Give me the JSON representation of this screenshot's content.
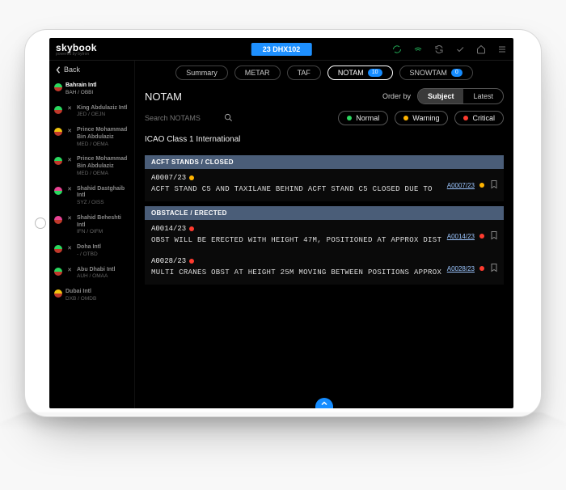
{
  "brand": {
    "name": "skybook",
    "sub": "powered by bytron"
  },
  "flight_pill": "23 DHX102",
  "nav": {
    "back": "Back"
  },
  "airports": [
    {
      "name": "Bahrain Intl",
      "code": "BAH / OBBI",
      "c1": "#2bd85f",
      "c2": "#c0392b",
      "selected": true,
      "alt": false
    },
    {
      "name": "King Abdulaziz Intl",
      "code": "JED / OEJN",
      "c1": "#2bd85f",
      "c2": "#c0392b",
      "alt": true
    },
    {
      "name": "Prince Mohammad Bin Abdulaziz",
      "code": "MED / OEMA",
      "c1": "#f1c40f",
      "c2": "#c0392b",
      "alt": true
    },
    {
      "name": "Prince Mohammad Bin Abdulaziz",
      "code": "MED / OEMA",
      "c1": "#2bd85f",
      "c2": "#c0392b",
      "alt": true
    },
    {
      "name": "Shahid Dastghaib Intl",
      "code": "SYZ / OISS",
      "c1": "#e84393",
      "c2": "#2bd85f",
      "alt": true
    },
    {
      "name": "Shahid Beheshti Intl",
      "code": "IFN / OIFM",
      "c1": "#e84393",
      "c2": "#c0392b",
      "alt": true
    },
    {
      "name": "Doha Intl",
      "code": "- / OTBD",
      "c1": "#2bd85f",
      "c2": "#c0392b",
      "alt": true
    },
    {
      "name": "Abu Dhabi Intl",
      "code": "AUH / OMAA",
      "c1": "#2bd85f",
      "c2": "#c0392b",
      "alt": true
    },
    {
      "name": "Dubai Intl",
      "code": "DXB / OMDB",
      "c1": "#f1c40f",
      "c2": "#c0392b",
      "alt": false
    }
  ],
  "tabs": [
    {
      "label": "Summary",
      "active": false
    },
    {
      "label": "METAR",
      "active": false
    },
    {
      "label": "TAF",
      "active": false
    },
    {
      "label": "NOTAM",
      "active": true,
      "badge": "10"
    },
    {
      "label": "SNOWTAM",
      "active": false,
      "badge": "0"
    }
  ],
  "page_title": "NOTAM",
  "order_by": {
    "label": "Order by",
    "options": [
      "Subject",
      "Latest"
    ],
    "selected": "Subject"
  },
  "search": {
    "placeholder": "Search NOTAMS"
  },
  "filters": [
    {
      "label": "Normal",
      "color": "g"
    },
    {
      "label": "Warning",
      "color": "y"
    },
    {
      "label": "Critical",
      "color": "r"
    }
  ],
  "section_heading": "ICAO Class 1 International",
  "groups": [
    {
      "title": "ACFT STANDS / CLOSED",
      "items": [
        {
          "id": "A0007/23",
          "sev": "y",
          "text": "ACFT STAND C5 AND TAXILANE BEHIND ACFT STAND C5 CLOSED DUE TO",
          "link": "A0007/23"
        }
      ]
    },
    {
      "title": "OBSTACLE / ERECTED",
      "items": [
        {
          "id": "A0014/23",
          "sev": "r",
          "text": "OBST WILL BE ERECTED WITH HEIGHT 47M, POSITIONED AT APPROX DIST",
          "link": "A0014/23"
        },
        {
          "id": "A0028/23",
          "sev": "r",
          "text": "MULTI CRANES OBST AT HEIGHT 25M MOVING BETWEEN POSITIONS APPROX",
          "link": "A0028/23"
        }
      ]
    }
  ]
}
